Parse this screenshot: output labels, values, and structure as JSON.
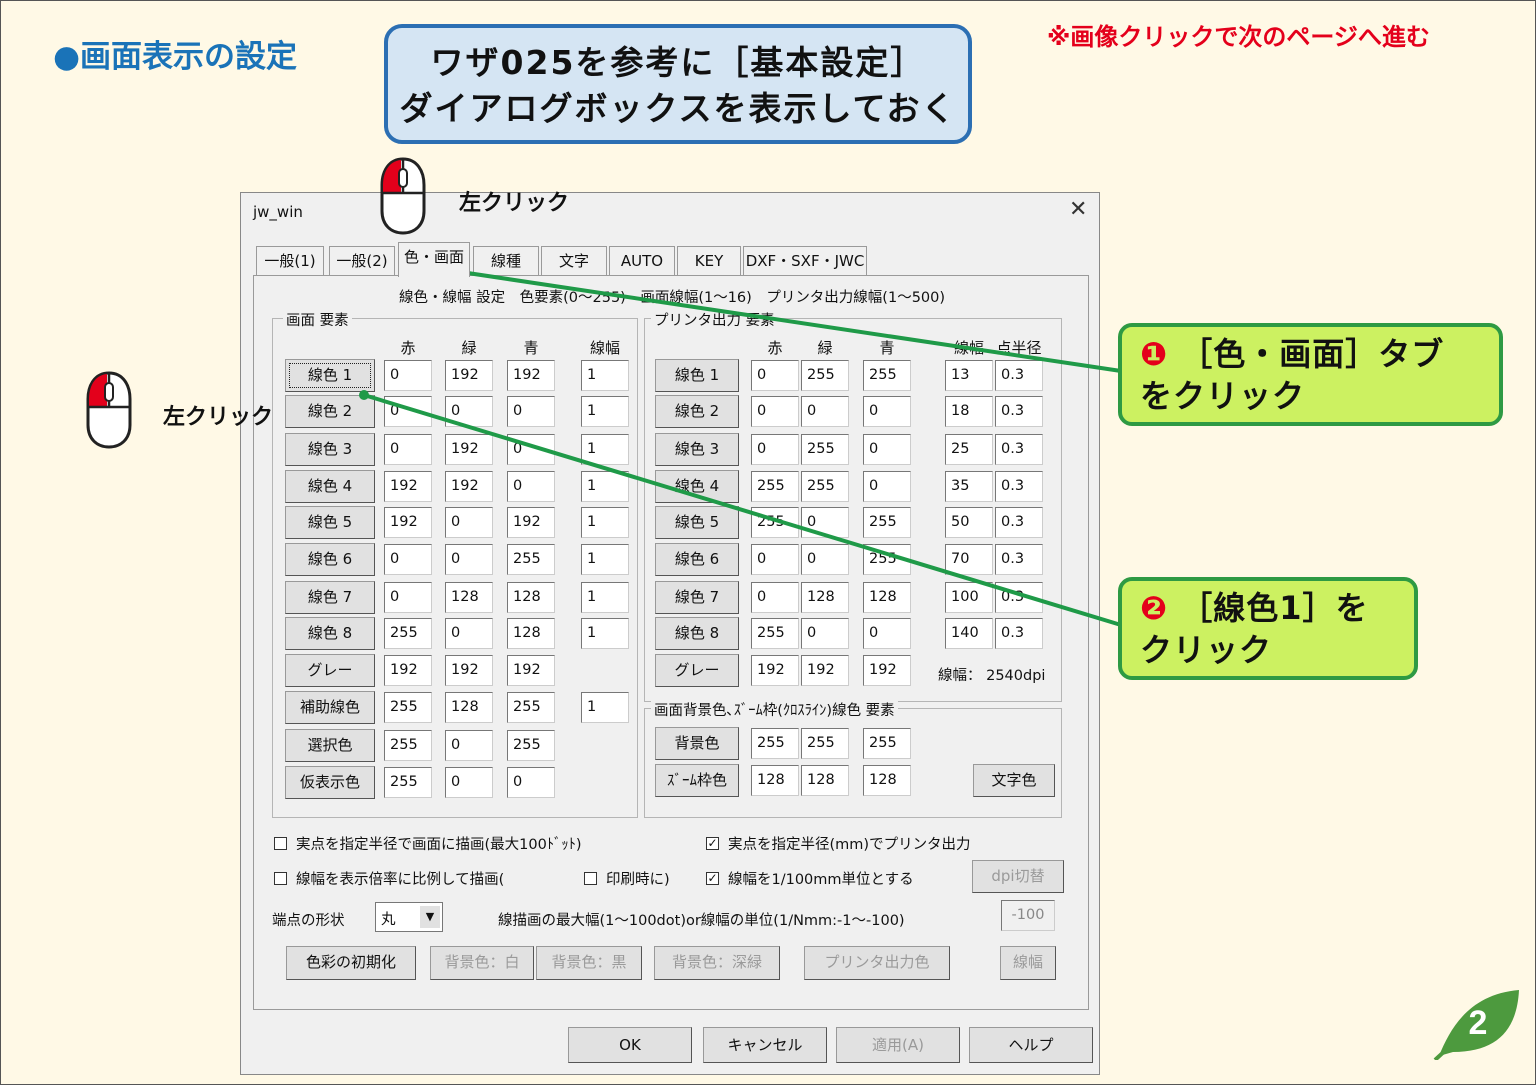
{
  "slide": {
    "title": "●画面表示の設定",
    "notice": "※画像クリックで次のページへ進む",
    "intro_line1": "ワザ025を参考に［基本設定］",
    "intro_line2": "ダイアログボックスを表示しておく",
    "click_label_top": "左クリック",
    "click_label_left": "左クリック",
    "step1_num": "❶",
    "step1_line1": "［色・画面］タブ",
    "step1_line2": "をクリック",
    "step2_num": "❷",
    "step2_line1": "［線色1］を",
    "step2_line2": "クリック",
    "page_number": "2",
    "colors": {
      "title": "#1a73b8",
      "notice": "#e4001b",
      "callout_green_bg": "#ccf161",
      "callout_green_border": "#2e9a43",
      "callout_blue_bg": "#d5e5f3",
      "callout_blue_border": "#2c6fb3",
      "leaf": "#4d9a3e",
      "line": "#1f9a48"
    }
  },
  "dialog": {
    "title": "jw_win",
    "close": "✕",
    "tabs": [
      "一般(1)",
      "一般(2)",
      "色・画面",
      "線種",
      "文字",
      "AUTO",
      "KEY",
      "DXF・SXF・JWC"
    ],
    "active_tab": "色・画面",
    "heading": "線色・線幅 設定　色要素(0〜255)　画面線幅(1〜16)　プリンタ出力線幅(1〜500)",
    "screen_group": {
      "legend": "画面 要素",
      "headers": [
        "赤",
        "緑",
        "青",
        "線幅"
      ],
      "rows": [
        {
          "label": "線色 1",
          "r": "0",
          "g": "192",
          "b": "192",
          "w": "1"
        },
        {
          "label": "線色 2",
          "r": "0",
          "g": "0",
          "b": "0",
          "w": "1"
        },
        {
          "label": "線色 3",
          "r": "0",
          "g": "192",
          "b": "0",
          "w": "1"
        },
        {
          "label": "線色 4",
          "r": "192",
          "g": "192",
          "b": "0",
          "w": "1"
        },
        {
          "label": "線色 5",
          "r": "192",
          "g": "0",
          "b": "192",
          "w": "1"
        },
        {
          "label": "線色 6",
          "r": "0",
          "g": "0",
          "b": "255",
          "w": "1"
        },
        {
          "label": "線色 7",
          "r": "0",
          "g": "128",
          "b": "128",
          "w": "1"
        },
        {
          "label": "線色 8",
          "r": "255",
          "g": "0",
          "b": "128",
          "w": "1"
        },
        {
          "label": "グレー",
          "r": "192",
          "g": "192",
          "b": "192",
          "w": ""
        },
        {
          "label": "補助線色",
          "r": "255",
          "g": "128",
          "b": "255",
          "w": "1"
        },
        {
          "label": "選択色",
          "r": "255",
          "g": "0",
          "b": "255",
          "w": ""
        },
        {
          "label": "仮表示色",
          "r": "255",
          "g": "0",
          "b": "0",
          "w": ""
        }
      ]
    },
    "printer_group": {
      "legend": "プリンタ出力 要素",
      "headers": [
        "赤",
        "緑",
        "青",
        "線幅",
        "点半径"
      ],
      "rows": [
        {
          "label": "線色 1",
          "r": "0",
          "g": "255",
          "b": "255",
          "w": "13",
          "p": "0.3"
        },
        {
          "label": "線色 2",
          "r": "0",
          "g": "0",
          "b": "0",
          "w": "18",
          "p": "0.3"
        },
        {
          "label": "線色 3",
          "r": "0",
          "g": "255",
          "b": "0",
          "w": "25",
          "p": "0.3"
        },
        {
          "label": "線色 4",
          "r": "255",
          "g": "255",
          "b": "0",
          "w": "35",
          "p": "0.3"
        },
        {
          "label": "線色 5",
          "r": "255",
          "g": "0",
          "b": "255",
          "w": "50",
          "p": "0.3"
        },
        {
          "label": "線色 6",
          "r": "0",
          "g": "0",
          "b": "255",
          "w": "70",
          "p": "0.3"
        },
        {
          "label": "線色 7",
          "r": "0",
          "g": "128",
          "b": "128",
          "w": "100",
          "p": "0.3"
        },
        {
          "label": "線色 8",
          "r": "255",
          "g": "0",
          "b": "0",
          "w": "140",
          "p": "0.3"
        },
        {
          "label": "グレー",
          "r": "192",
          "g": "192",
          "b": "192",
          "w": "",
          "p": ""
        }
      ],
      "dpi_text": "線幅： 2540dpi"
    },
    "bg_group": {
      "legend": "画面背景色､ｽﾞｰﾑ枠(ｸﾛｽﾗｲﾝ)線色 要素",
      "rows": [
        {
          "label": "背景色",
          "r": "255",
          "g": "255",
          "b": "255"
        },
        {
          "label": "ｽﾞｰﾑ枠色",
          "r": "128",
          "g": "128",
          "b": "128"
        }
      ],
      "text_color_button": "文字色"
    },
    "options": {
      "opt1": {
        "label": "実点を指定半径で画面に描画(最大100ﾄﾞｯﾄ)",
        "checked": false
      },
      "opt2": {
        "label": "実点を指定半径(mm)でプリンタ出力",
        "checked": true
      },
      "opt3": {
        "label": "線幅を表示倍率に比例して描画(",
        "checked": false
      },
      "opt4": {
        "label": "印刷時に)",
        "checked": false
      },
      "opt5": {
        "label": "線幅を1/100mm単位とする",
        "checked": true
      },
      "dpi_button": "dpi切替",
      "endpoint_label": "端点の形状",
      "endpoint_value": "丸",
      "max_width_label": "線描画の最大幅(1〜100dot)or線幅の単位(1/Nmm:-1〜-100)",
      "max_width_value": "-100",
      "check_mark": "✓"
    },
    "bottom_buttons": [
      "色彩の初期化",
      "背景色：白",
      "背景色：黒",
      "背景色：深緑",
      "プリンタ出力色",
      "線幅"
    ],
    "footer_buttons": [
      "OK",
      "キャンセル",
      "適用(A)",
      "ヘルプ"
    ]
  }
}
